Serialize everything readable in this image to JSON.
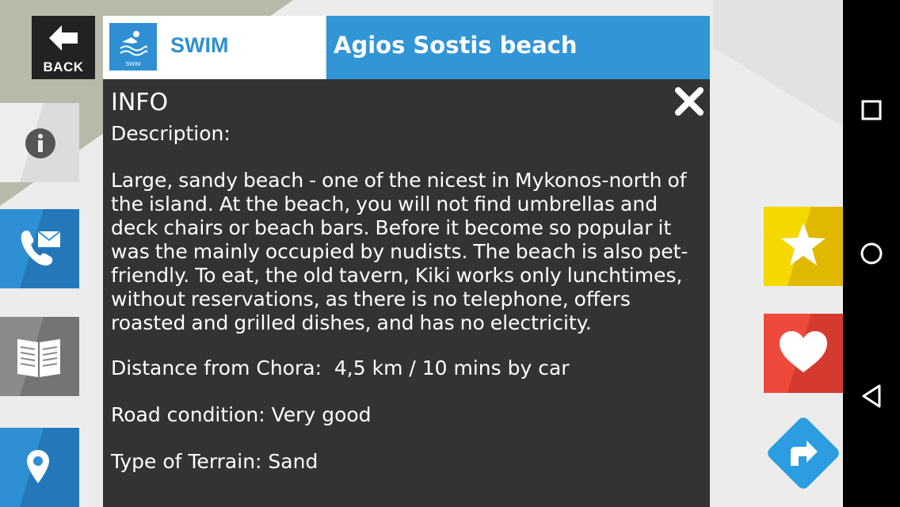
{
  "back_button": {
    "label": "BACK"
  },
  "header": {
    "category_logo_text": "SWIM",
    "category_label": "SWIM",
    "beach_name": "Agios Sostis beach"
  },
  "info_panel": {
    "heading": "INFO",
    "description_label": "Description:",
    "description": "Large, sandy beach - one of the nicest in Mykonos-north of the island. At the beach, you will not find umbrellas and deck chairs or beach bars. Before it become so popular it was the mainly occupied by nudists. The beach is also pet-friendly. To eat, the old tavern, Kiki works only lunchtimes, without reservations, as there is no telephone, offers roasted and grilled dishes, and has no electricity.",
    "distance": "Distance from Chora:  4,5 km / 10 mins by car",
    "road_condition": "Road condition: Very good",
    "terrain": "Type of Terrain: Sand"
  },
  "left_tiles": [
    {
      "icon": "info-icon",
      "color": "#ededed"
    },
    {
      "icon": "contact-icon",
      "color": "#2f8fd3"
    },
    {
      "icon": "newspaper-icon",
      "color": "#8a8a8a"
    },
    {
      "icon": "map-pin-icon",
      "color": "#2f8fd3"
    }
  ],
  "right_tiles": [
    {
      "icon": "star-icon",
      "color": "#f5d800"
    },
    {
      "icon": "heart-icon",
      "color": "#ee4a3c"
    },
    {
      "icon": "directions-icon",
      "color": "#2f8fd3"
    }
  ],
  "nav_bar": [
    "recent-apps-icon",
    "home-icon",
    "back-icon"
  ]
}
